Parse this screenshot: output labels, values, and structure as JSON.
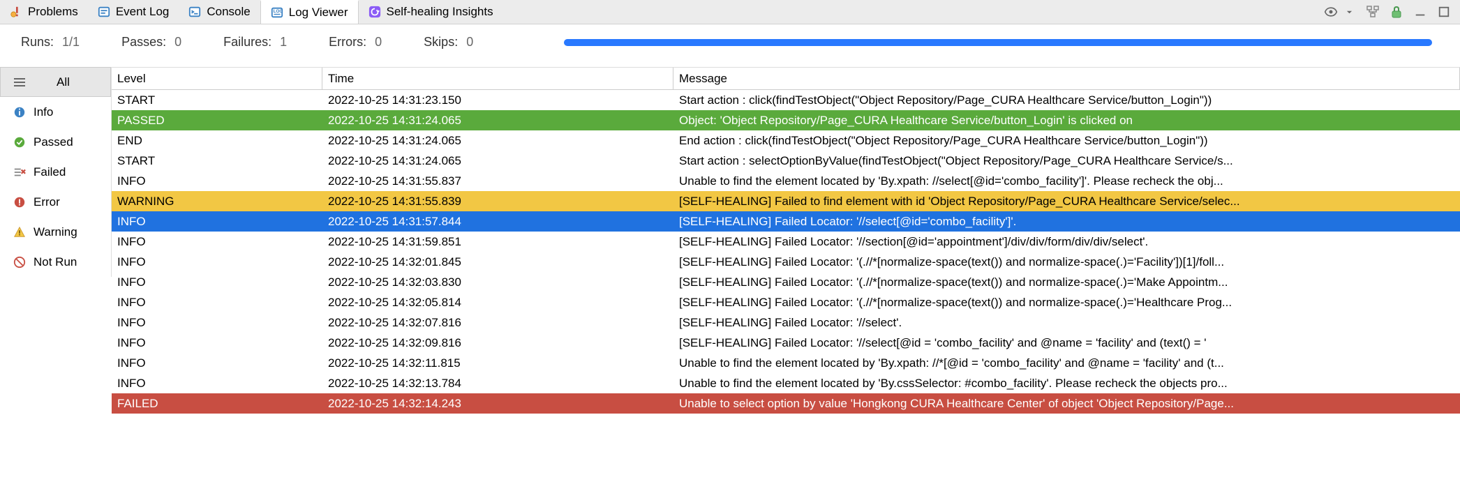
{
  "tabs": [
    {
      "label": "Problems"
    },
    {
      "label": "Event Log"
    },
    {
      "label": "Console"
    },
    {
      "label": "Log Viewer"
    },
    {
      "label": "Self-healing Insights"
    }
  ],
  "stats": {
    "runs_label": "Runs:",
    "runs_value": "1/1",
    "passes_label": "Passes:",
    "passes_value": "0",
    "failures_label": "Failures:",
    "failures_value": "1",
    "errors_label": "Errors:",
    "errors_value": "0",
    "skips_label": "Skips:",
    "skips_value": "0"
  },
  "sidebar": {
    "items": [
      {
        "label": "All"
      },
      {
        "label": "Info"
      },
      {
        "label": "Passed"
      },
      {
        "label": "Failed"
      },
      {
        "label": "Error"
      },
      {
        "label": "Warning"
      },
      {
        "label": "Not Run"
      }
    ]
  },
  "columns": {
    "level": "Level",
    "time": "Time",
    "message": "Message"
  },
  "rows": [
    {
      "level": "START",
      "time": "2022-10-25 14:31:23.150",
      "message": "Start action : click(findTestObject(\"Object Repository/Page_CURA Healthcare Service/button_Login\"))",
      "status": ""
    },
    {
      "level": "PASSED",
      "time": "2022-10-25 14:31:24.065",
      "message": "Object: 'Object Repository/Page_CURA Healthcare Service/button_Login' is clicked on",
      "status": "passed"
    },
    {
      "level": "END",
      "time": "2022-10-25 14:31:24.065",
      "message": "End action : click(findTestObject(\"Object Repository/Page_CURA Healthcare Service/button_Login\"))",
      "status": ""
    },
    {
      "level": "START",
      "time": "2022-10-25 14:31:24.065",
      "message": "Start action : selectOptionByValue(findTestObject(\"Object Repository/Page_CURA Healthcare Service/s...",
      "status": ""
    },
    {
      "level": "INFO",
      "time": "2022-10-25 14:31:55.837",
      "message": "Unable to find the element located by 'By.xpath: //select[@id='combo_facility']'. Please recheck the obj...",
      "status": ""
    },
    {
      "level": "WARNING",
      "time": "2022-10-25 14:31:55.839",
      "message": "[SELF-HEALING] Failed to find element with id 'Object Repository/Page_CURA Healthcare Service/selec...",
      "status": "warning"
    },
    {
      "level": "INFO",
      "time": "2022-10-25 14:31:57.844",
      "message": "[SELF-HEALING] Failed Locator: '//select[@id='combo_facility']'.",
      "status": "selected"
    },
    {
      "level": "INFO",
      "time": "2022-10-25 14:31:59.851",
      "message": "[SELF-HEALING] Failed Locator: '//section[@id='appointment']/div/div/form/div/div/select'.",
      "status": ""
    },
    {
      "level": "INFO",
      "time": "2022-10-25 14:32:01.845",
      "message": "[SELF-HEALING] Failed Locator: '(.//*[normalize-space(text()) and normalize-space(.)='Facility'])[1]/foll...",
      "status": ""
    },
    {
      "level": "INFO",
      "time": "2022-10-25 14:32:03.830",
      "message": "[SELF-HEALING] Failed Locator: '(.//*[normalize-space(text()) and normalize-space(.)='Make Appointm...",
      "status": ""
    },
    {
      "level": "INFO",
      "time": "2022-10-25 14:32:05.814",
      "message": "[SELF-HEALING] Failed Locator: '(.//*[normalize-space(text()) and normalize-space(.)='Healthcare Prog...",
      "status": ""
    },
    {
      "level": "INFO",
      "time": "2022-10-25 14:32:07.816",
      "message": "[SELF-HEALING] Failed Locator: '//select'.",
      "status": ""
    },
    {
      "level": "INFO",
      "time": "2022-10-25 14:32:09.816",
      "message": "[SELF-HEALING] Failed Locator: '//select[@id = 'combo_facility' and @name = 'facility' and (text() = '",
      "status": ""
    },
    {
      "level": "INFO",
      "time": "2022-10-25 14:32:11.815",
      "message": "Unable to find the element located by 'By.xpath: //*[@id = 'combo_facility' and @name = 'facility' and (t...",
      "status": ""
    },
    {
      "level": "INFO",
      "time": "2022-10-25 14:32:13.784",
      "message": "Unable to find the element located by 'By.cssSelector: #combo_facility'. Please recheck the objects pro...",
      "status": ""
    },
    {
      "level": "FAILED",
      "time": "2022-10-25 14:32:14.243",
      "message": "Unable to select option by value 'Hongkong CURA Healthcare Center' of object 'Object Repository/Page...",
      "status": "failed"
    }
  ]
}
